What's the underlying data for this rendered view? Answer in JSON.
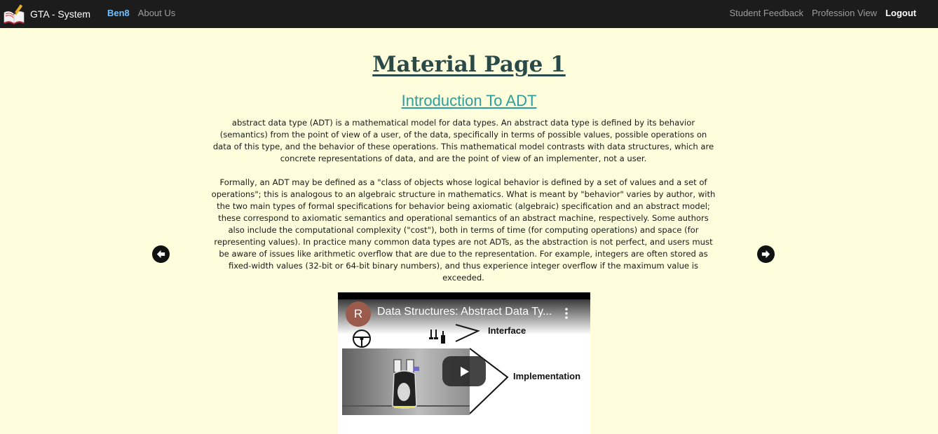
{
  "nav": {
    "brand": "GTA - System",
    "user": "Ben8",
    "about": "About Us",
    "feedback": "Student Feedback",
    "profession": "Profession View",
    "logout": "Logout"
  },
  "page": {
    "title": "Material Page 1",
    "section_title": "Introduction To ADT",
    "paragraph1": "abstract data type (ADT) is a mathematical model for data types. An abstract data type is defined by its behavior (semantics) from the point of view of a user, of the data, specifically in terms of possible values, possible operations on data of this type, and the behavior of these operations. This mathematical model contrasts with data structures, which are concrete representations of data, and are the point of view of an implementer, not a user.",
    "paragraph2": "Formally, an ADT may be defined as a \"class of objects whose logical behavior is defined by a set of values and a set of operations\"; this is analogous to an algebraic structure in mathematics. What is meant by \"behavior\" varies by author, with the two main types of formal specifications for behavior being axiomatic (algebraic) specification and an abstract model; these correspond to axiomatic semantics and operational semantics of an abstract machine, respectively. Some authors also include the computational complexity (\"cost\"), both in terms of time (for computing operations) and space (for representing values). In practice many common data types are not ADTs, as the abstraction is not perfect, and users must be aware of issues like arithmetic overflow that are due to the representation. For example, integers are often stored as fixed-width values (32-bit or 64-bit binary numbers), and thus experience integer overflow if the maximum value is exceeded."
  },
  "video": {
    "channel_initial": "R",
    "title": "Data Structures: Abstract Data Ty...",
    "label_interface": "Interface",
    "label_implementation": "Implementation"
  },
  "icons": {
    "prev": "arrow-left-circle-icon",
    "next": "arrow-right-circle-icon",
    "brand": "book-pencil-icon"
  },
  "colors": {
    "background": "#fefedd",
    "navbar": "#1c1c1c",
    "user_link": "#6fc1ff",
    "title": "#2a4a4a",
    "section_title": "#2b9e9e"
  }
}
